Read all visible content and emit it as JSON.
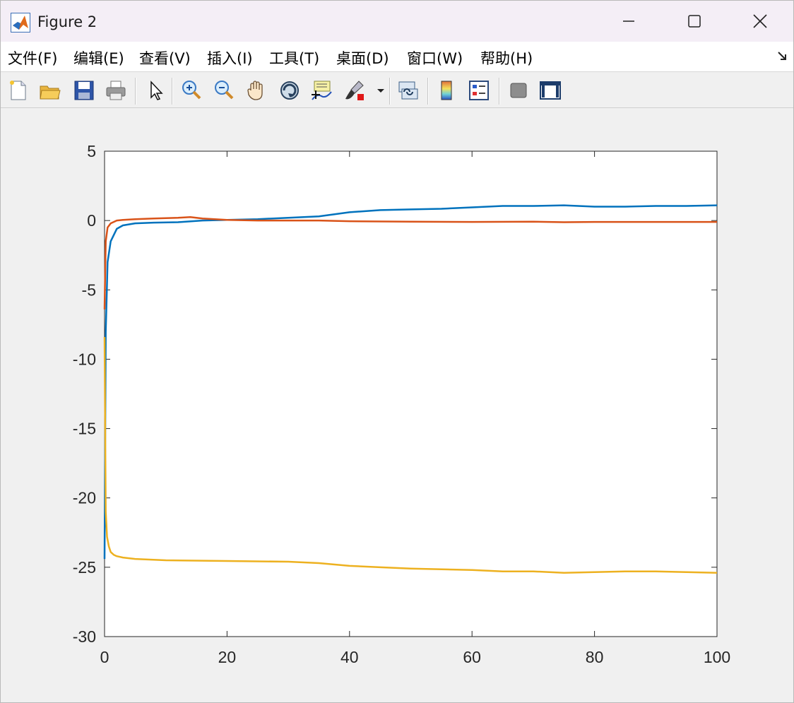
{
  "window": {
    "title": "Figure 2",
    "controls": {
      "minimize": "minimize",
      "maximize": "maximize",
      "close": "close"
    }
  },
  "menu": {
    "items": [
      {
        "label": "文件(F)"
      },
      {
        "label": "编辑(E)"
      },
      {
        "label": "查看(V)"
      },
      {
        "label": "插入(I)"
      },
      {
        "label": "工具(T)"
      },
      {
        "label": "桌面(D)"
      },
      {
        "label": "窗口(W)"
      },
      {
        "label": "帮助(H)"
      }
    ],
    "dock_icon": "undock-arrow-icon"
  },
  "toolbar": {
    "icons": [
      "new-figure-icon",
      "open-file-icon",
      "save-icon",
      "print-icon",
      "select-pointer-icon",
      "zoom-in-icon",
      "zoom-out-icon",
      "pan-hand-icon",
      "rotate-3d-icon",
      "data-cursor-icon",
      "brush-icon",
      "brush-dropdown-icon",
      "link-plot-icon",
      "colorbar-icon",
      "legend-icon",
      "hide-plot-tools-icon",
      "show-plot-tools-icon"
    ]
  },
  "chart_data": {
    "type": "line",
    "title": "",
    "xlabel": "",
    "ylabel": "",
    "xlim": [
      0,
      100
    ],
    "ylim": [
      -30,
      5
    ],
    "xticks": [
      0,
      20,
      40,
      60,
      80,
      100
    ],
    "yticks": [
      5,
      0,
      -5,
      -10,
      -15,
      -20,
      -25,
      -30
    ],
    "xtick_labels": [
      "0",
      "20",
      "40",
      "60",
      "80",
      "100"
    ],
    "ytick_labels": [
      "5",
      "0",
      "-5",
      "-10",
      "-15",
      "-20",
      "-25",
      "-30"
    ],
    "grid": false,
    "legend": "none",
    "series": [
      {
        "color": "#0072BD",
        "x": [
          0,
          0.2,
          0.5,
          1,
          2,
          3,
          5,
          8,
          12,
          16,
          20,
          25,
          30,
          35,
          40,
          45,
          50,
          55,
          60,
          65,
          70,
          75,
          80,
          85,
          90,
          95,
          100
        ],
        "y": [
          -24.4,
          -8.0,
          -3.0,
          -1.5,
          -0.6,
          -0.35,
          -0.2,
          -0.15,
          -0.12,
          0.0,
          0.05,
          0.1,
          0.2,
          0.3,
          0.6,
          0.75,
          0.8,
          0.85,
          0.95,
          1.05,
          1.05,
          1.1,
          1.0,
          1.0,
          1.05,
          1.05,
          1.1
        ]
      },
      {
        "color": "#D95319",
        "x": [
          0,
          0.2,
          0.5,
          1,
          2,
          3,
          5,
          8,
          12,
          14,
          16,
          20,
          25,
          30,
          35,
          40,
          50,
          60,
          70,
          75,
          80,
          90,
          100
        ],
        "y": [
          -6.4,
          -1.5,
          -0.5,
          -0.2,
          0.0,
          0.05,
          0.1,
          0.15,
          0.2,
          0.25,
          0.15,
          0.05,
          0.0,
          0.0,
          0.0,
          -0.05,
          -0.08,
          -0.1,
          -0.08,
          -0.12,
          -0.1,
          -0.1,
          -0.1
        ]
      },
      {
        "color": "#EDB120",
        "x": [
          0,
          0.1,
          0.2,
          0.4,
          0.7,
          1,
          1.5,
          2,
          3,
          5,
          10,
          20,
          30,
          35,
          40,
          45,
          50,
          60,
          65,
          70,
          75,
          80,
          85,
          90,
          95,
          100
        ],
        "y": [
          -8.4,
          -15.0,
          -21.0,
          -22.8,
          -23.5,
          -23.9,
          -24.1,
          -24.2,
          -24.3,
          -24.4,
          -24.5,
          -24.55,
          -24.6,
          -24.7,
          -24.9,
          -25.0,
          -25.1,
          -25.2,
          -25.3,
          -25.3,
          -25.4,
          -25.35,
          -25.3,
          -25.3,
          -25.35,
          -25.4
        ]
      }
    ]
  }
}
